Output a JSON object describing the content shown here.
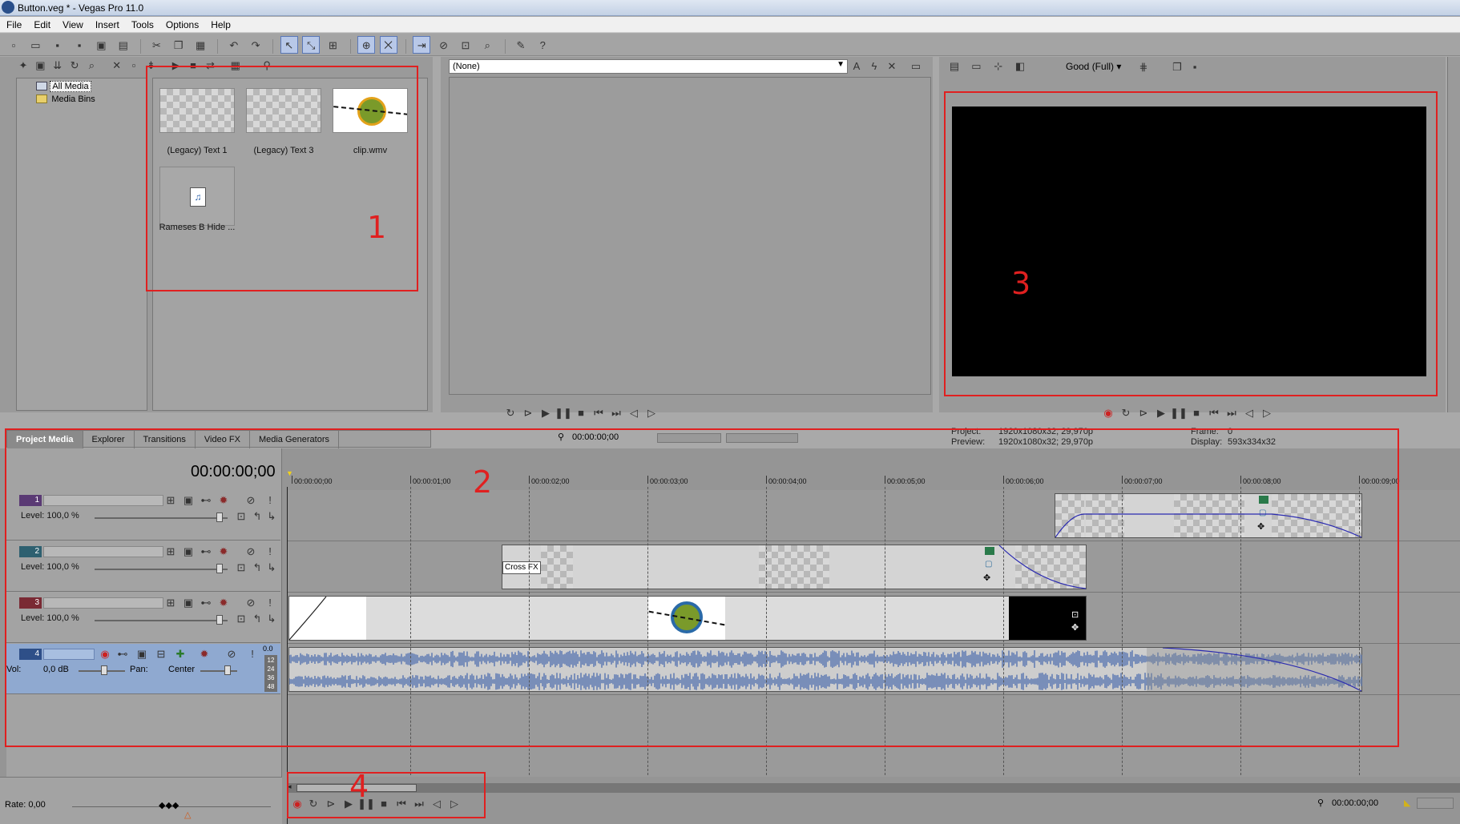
{
  "window": {
    "title": "Button.veg * - Vegas Pro 11.0"
  },
  "menu": [
    "File",
    "Edit",
    "View",
    "Insert",
    "Tools",
    "Options",
    "Help"
  ],
  "media_tree": {
    "root": "All Media",
    "child": "Media Bins"
  },
  "media_items": [
    {
      "label": "(Legacy) Text 1"
    },
    {
      "label": "(Legacy) Text 3"
    },
    {
      "label": "clip.wmv"
    },
    {
      "label": "Rameses B Hide ..."
    }
  ],
  "trimmer": {
    "dropdown_value": "(None)",
    "time": "00:00:00;00"
  },
  "preview": {
    "quality": "Good (Full)",
    "project_label": "Project:",
    "project_value": "1920x1080x32; 29,970p",
    "preview_label": "Preview:",
    "preview_value": "1920x1080x32; 29,970p",
    "frame_label": "Frame:",
    "frame_value": "0",
    "display_label": "Display:",
    "display_value": "593x334x32"
  },
  "tabs": [
    "Project Media",
    "Explorer",
    "Transitions",
    "Video FX",
    "Media Generators"
  ],
  "timeline": {
    "timecode": "00:00:00;00",
    "ruler": [
      "00:00:00;00",
      "00:00:01;00",
      "00:00:02;00",
      "00:00:03;00",
      "00:00:04;00",
      "00:00:05;00",
      "00:00:06;00",
      "00:00:07;00",
      "00:00:08;00",
      "00:00:09;00"
    ],
    "tracks": [
      {
        "num": "1",
        "level": "Level: 100,0 %"
      },
      {
        "num": "2",
        "level": "Level: 100,0 %"
      },
      {
        "num": "3",
        "level": "Level: 100,0 %"
      }
    ],
    "audio_track": {
      "num": "4",
      "vol": "Vol:",
      "vol_value": "0,0 dB",
      "pan": "Pan:",
      "pan_value": "Center",
      "meter_top": "0.0",
      "meter_values": [
        "12",
        "24",
        "36",
        "48"
      ]
    },
    "clip_crossfx": "Cross FX",
    "rate": "Rate: 0,00",
    "bottom_time": "00:00:00;00"
  },
  "annotations": [
    "1",
    "2",
    "3",
    "4"
  ],
  "colors": {
    "annotation": "#e02020",
    "audio_track": "#8fa9d0",
    "waveform": "#5573b0",
    "preview_bg": "#000000"
  }
}
